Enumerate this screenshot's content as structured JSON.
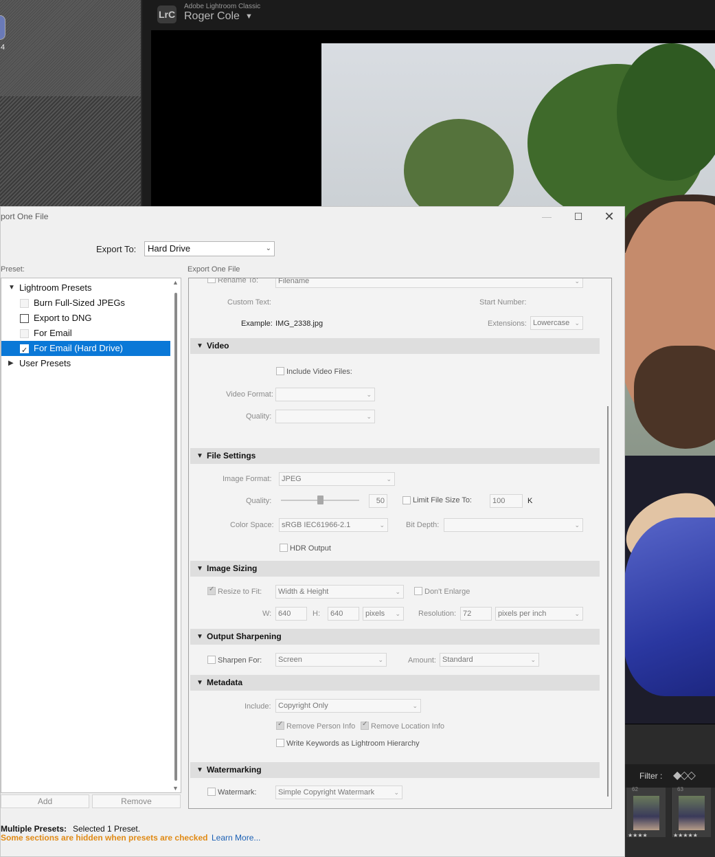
{
  "background": {
    "partial_number": "4",
    "app_name": "Adobe Lightroom Classic",
    "badge": "LrC",
    "user_name": "Roger Cole",
    "filter_label": "Filter :",
    "thumbs": [
      {
        "number": "62",
        "stars": "★★★★"
      },
      {
        "number": "63",
        "stars": "★★★★★"
      }
    ]
  },
  "dialog": {
    "title": "port One File",
    "export_to_label": "Export To:",
    "export_to_value": "Hard Drive",
    "preset_heading": "Preset:",
    "presets": {
      "lightroom_group": "Lightroom Presets",
      "items": [
        "Burn Full-Sized JPEGs",
        "Export to DNG",
        "For Email",
        "For Email (Hard Drive)"
      ],
      "user_group": "User Presets"
    },
    "add_label": "Add",
    "remove_label": "Remove",
    "status": {
      "multiple_label": "Multiple Presets:",
      "selected_text": "Selected 1 Preset.",
      "warning": "Some sections are hidden when presets are checked",
      "learn_more": "Learn More..."
    },
    "main_heading": "Export One File",
    "file_naming": {
      "rename_label": "Rename To:",
      "rename_value": "Filename",
      "custom_text_label": "Custom Text:",
      "start_number_label": "Start Number:",
      "example_label": "Example:",
      "example_value": "IMG_2338.jpg",
      "extensions_label": "Extensions:",
      "extensions_value": "Lowercase"
    },
    "video": {
      "title": "Video",
      "include_label": "Include Video Files:",
      "format_label": "Video Format:",
      "quality_label": "Quality:"
    },
    "file_settings": {
      "title": "File Settings",
      "format_label": "Image Format:",
      "format_value": "JPEG",
      "quality_label": "Quality:",
      "quality_value": "50",
      "limit_label": "Limit File Size To:",
      "limit_value": "100",
      "limit_unit": "K",
      "color_space_label": "Color Space:",
      "color_space_value": "sRGB IEC61966-2.1",
      "bit_depth_label": "Bit Depth:",
      "hdr_label": "HDR Output"
    },
    "image_sizing": {
      "title": "Image Sizing",
      "resize_label": "Resize to Fit:",
      "resize_value": "Width & Height",
      "dont_enlarge_label": "Don't Enlarge",
      "w_label": "W:",
      "w_value": "640",
      "h_label": "H:",
      "h_value": "640",
      "unit_value": "pixels",
      "resolution_label": "Resolution:",
      "resolution_value": "72",
      "resolution_unit": "pixels per inch"
    },
    "output_sharpening": {
      "title": "Output Sharpening",
      "sharpen_label": "Sharpen For:",
      "sharpen_value": "Screen",
      "amount_label": "Amount:",
      "amount_value": "Standard"
    },
    "metadata": {
      "title": "Metadata",
      "include_label": "Include:",
      "include_value": "Copyright Only",
      "remove_person_label": "Remove Person Info",
      "remove_location_label": "Remove Location Info",
      "keywords_label": "Write Keywords as Lightroom Hierarchy"
    },
    "watermarking": {
      "title": "Watermarking",
      "watermark_label": "Watermark:",
      "watermark_value": "Simple Copyright Watermark"
    }
  },
  "colors": {
    "selection": "#0a78d7",
    "warning": "#e08a15",
    "link": "#1a5fb4"
  }
}
